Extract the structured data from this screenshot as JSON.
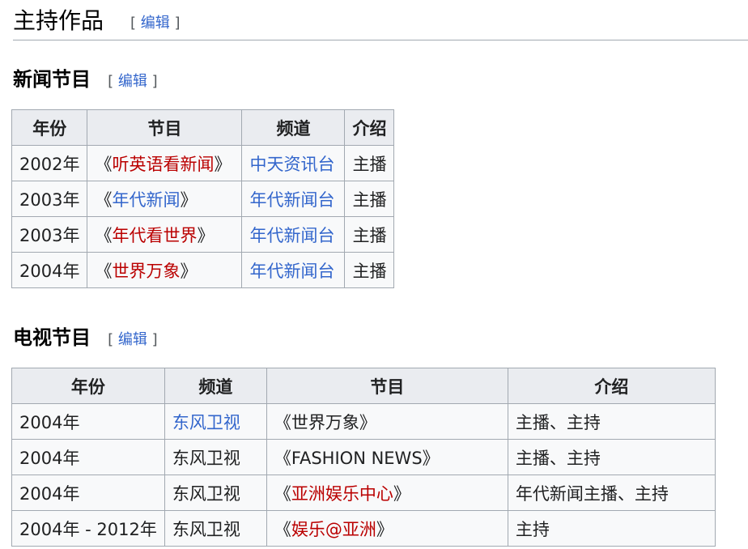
{
  "heading": {
    "title": "主持作品",
    "edit_open": "[",
    "edit": "编辑",
    "edit_close": "]"
  },
  "news": {
    "title": "新闻节目",
    "edit": "编辑",
    "headers": [
      "年份",
      "节目",
      "频道",
      "介绍"
    ],
    "rows": [
      {
        "year": "2002年",
        "program": "听英语看新闻",
        "program_link": "red",
        "channel": "中天资讯台",
        "channel_link": "blue",
        "intro": "主播"
      },
      {
        "year": "2003年",
        "program": "年代新闻",
        "program_link": "blue",
        "channel": "年代新闻台",
        "channel_link": "blue",
        "intro": "主播"
      },
      {
        "year": "2003年",
        "program": "年代看世界",
        "program_link": "red",
        "channel": "年代新闻台",
        "channel_link": "blue",
        "intro": "主播"
      },
      {
        "year": "2004年",
        "program": "世界万象",
        "program_link": "red",
        "channel": "年代新闻台",
        "channel_link": "blue",
        "intro": "主播"
      }
    ]
  },
  "tv": {
    "title": "电视节目",
    "edit": "编辑",
    "headers": [
      "年份",
      "频道",
      "节目",
      "介绍"
    ],
    "rows": [
      {
        "year": "2004年",
        "channel": "东风卫视",
        "channel_link": "blue",
        "program": "世界万象",
        "program_link": "none",
        "intro": "主播、主持"
      },
      {
        "year": "2004年",
        "channel": "东风卫视",
        "channel_link": "none",
        "program": "FASHION NEWS",
        "program_link": "none",
        "intro": "主播、主持"
      },
      {
        "year": "2004年",
        "channel": "东风卫视",
        "channel_link": "none",
        "program": "亚洲娱乐中心",
        "program_link": "red",
        "intro": "年代新闻主播、主持"
      },
      {
        "year": "2004年 - 2012年",
        "channel": "东风卫视",
        "channel_link": "none",
        "program": "娱乐@亚洲",
        "program_link": "red",
        "intro": "主持"
      }
    ]
  }
}
